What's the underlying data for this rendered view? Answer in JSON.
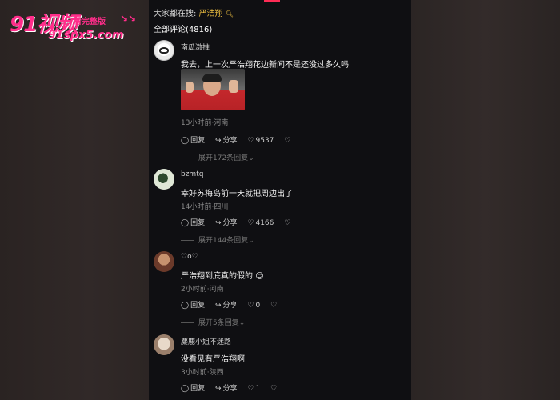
{
  "watermark": {
    "brand": "91视频",
    "tag": "看完整版",
    "arrows": "↘↘",
    "url": "91spx5.com"
  },
  "search_bar": {
    "prefix": "大家都在搜:",
    "keyword": "严浩翔",
    "icon": "search-icon"
  },
  "comments_header": {
    "label": "全部评论(4816)"
  },
  "actions": {
    "reply_label": "回复",
    "share_label": "分享"
  },
  "comments": [
    {
      "username": "南瓜激推",
      "text": "我去，上一次严浩翔花边新闻不是还没过多久吗",
      "meta": "13小时前·河南",
      "likes": "9537",
      "expand": "展开172条回复"
    },
    {
      "username": "bzmtq",
      "text": "幸好苏梅岛前一天就把周边出了",
      "meta": "14小时前·四川",
      "likes": "4166",
      "expand": "展开144条回复"
    },
    {
      "username": "♡o♡",
      "text": "严浩翔到底真的假的",
      "emoji": "😊",
      "meta": "2小时前·河南",
      "likes": "0",
      "expand": "展开5条回复"
    },
    {
      "username": "麋鹿小姐不迷路",
      "text": "没看见有严浩翔啊",
      "meta": "3小时前·陕西",
      "likes": "1"
    }
  ]
}
